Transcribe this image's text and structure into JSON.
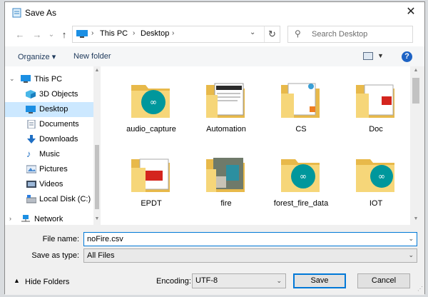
{
  "window": {
    "title": "Save As",
    "close_symbol": "✕"
  },
  "nav": {
    "back": "←",
    "forward": "→",
    "recent": "⌄",
    "up": "↑",
    "breadcrumbs": [
      "This PC",
      "Desktop"
    ],
    "separator": "›",
    "search_placeholder": "Search Desktop"
  },
  "toolbar": {
    "organize": "Organize ▾",
    "new_folder": "New folder",
    "help": "?"
  },
  "sidebar": {
    "items": [
      {
        "label": "This PC",
        "icon": "pc-icon"
      },
      {
        "label": "3D Objects",
        "icon": "cube-icon"
      },
      {
        "label": "Desktop",
        "icon": "desktop-icon",
        "selected": true
      },
      {
        "label": "Documents",
        "icon": "documents-icon"
      },
      {
        "label": "Downloads",
        "icon": "download-icon"
      },
      {
        "label": "Music",
        "icon": "music-icon"
      },
      {
        "label": "Pictures",
        "icon": "pictures-icon"
      },
      {
        "label": "Videos",
        "icon": "videos-icon"
      },
      {
        "label": "Local Disk (C:)",
        "icon": "disk-icon"
      },
      {
        "label": "Network",
        "icon": "network-icon"
      }
    ]
  },
  "files": [
    {
      "name": "audio_capture",
      "type": "arduino"
    },
    {
      "name": "Automation",
      "type": "screenshot"
    },
    {
      "name": "CS",
      "type": "docs"
    },
    {
      "name": "Doc",
      "type": "pdf"
    },
    {
      "name": "EPDT",
      "type": "pdf"
    },
    {
      "name": "fire",
      "type": "photo"
    },
    {
      "name": "forest_fire_data",
      "type": "arduino"
    },
    {
      "name": "IOT",
      "type": "arduino"
    }
  ],
  "form": {
    "file_name_label": "File name:",
    "file_name_value": "noFire.csv",
    "save_type_label": "Save as type:",
    "save_type_value": "All Files",
    "hide_folders": "Hide Folders",
    "encoding_label": "Encoding:",
    "encoding_value": "UTF-8",
    "save": "Save",
    "cancel": "Cancel"
  },
  "colors": {
    "accent": "#0078d7",
    "selection": "#cce8ff",
    "folder": "#f5cf6a",
    "arduino": "#00979c"
  }
}
